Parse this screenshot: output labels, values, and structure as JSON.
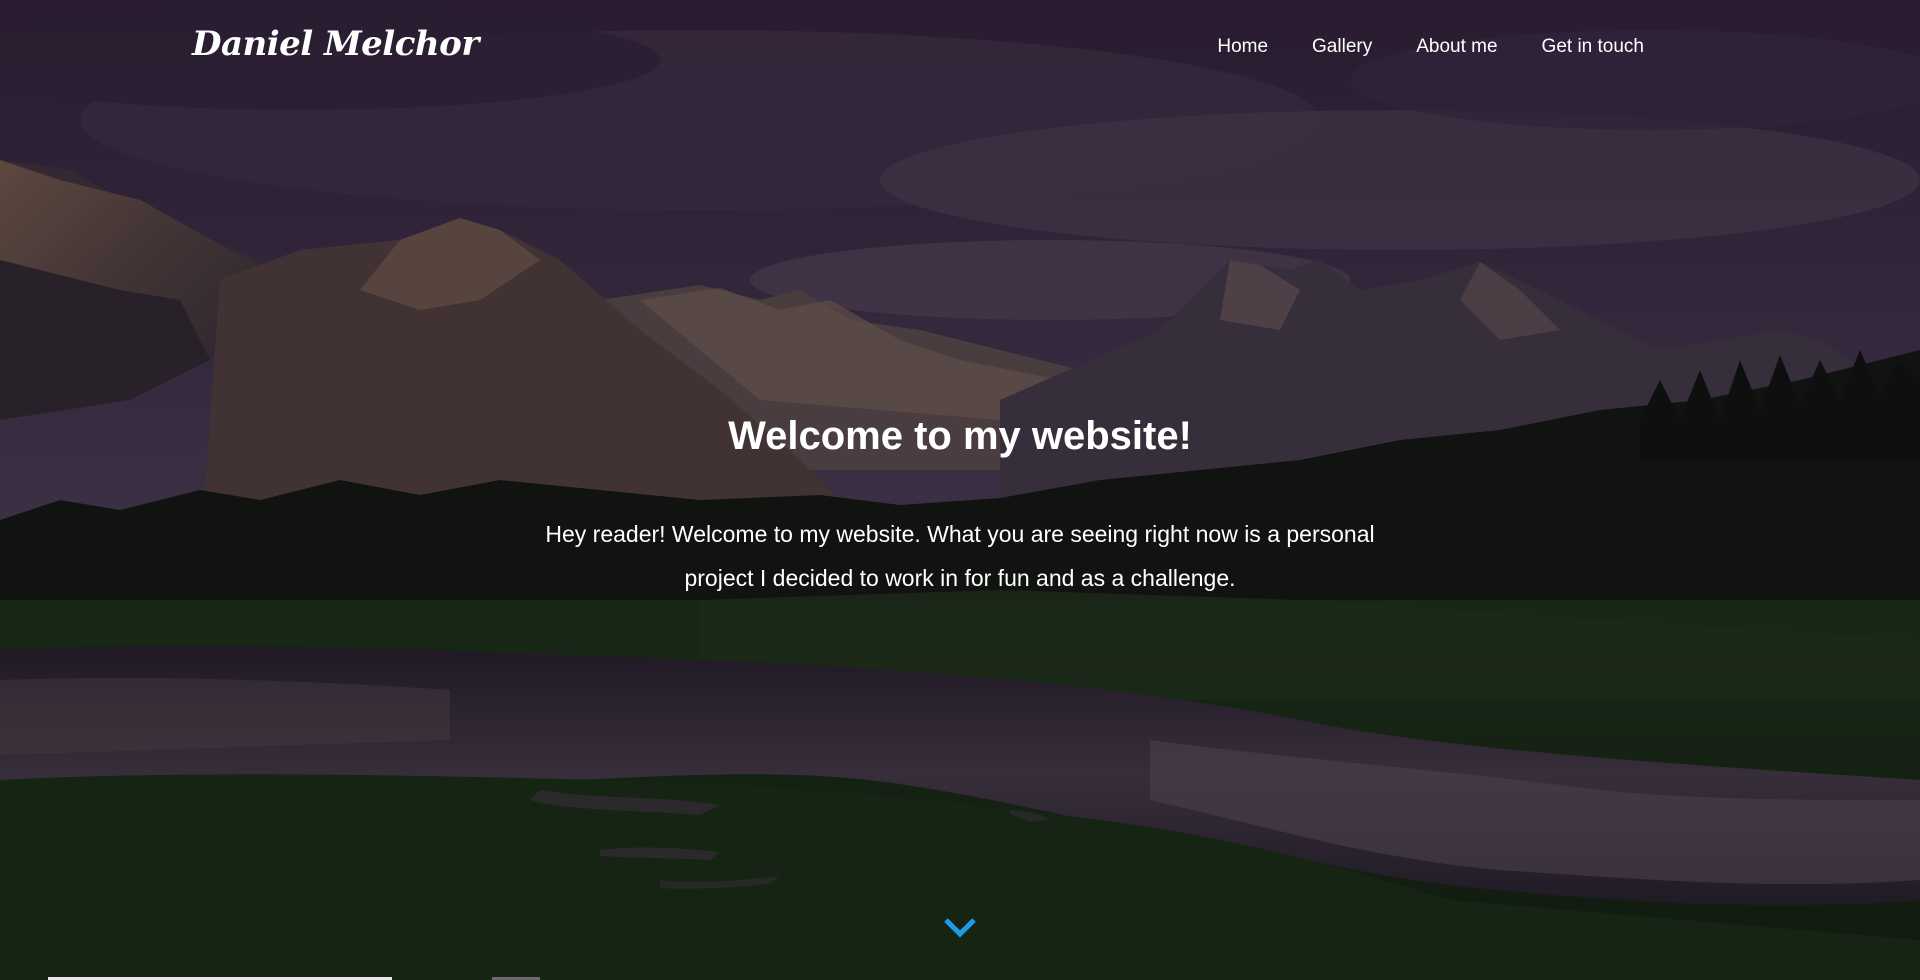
{
  "site": {
    "logo_text": "Daniel Melchor"
  },
  "nav": {
    "items": [
      {
        "label": "Home"
      },
      {
        "label": "Gallery"
      },
      {
        "label": "About me"
      },
      {
        "label": "Get in touch"
      }
    ]
  },
  "hero": {
    "title": "Welcome to my website!",
    "text": "Hey reader! Welcome to my website. What you are seeing right now is a personal project I decided to work in for fun and as a challenge.",
    "background": "mountain-lake-landscape",
    "scroll_icon": "chevron-down-icon"
  },
  "colors": {
    "accent": "#1e9be6",
    "text": "#ffffff",
    "sky": "#3a2a44",
    "grass": "#1f3518"
  }
}
